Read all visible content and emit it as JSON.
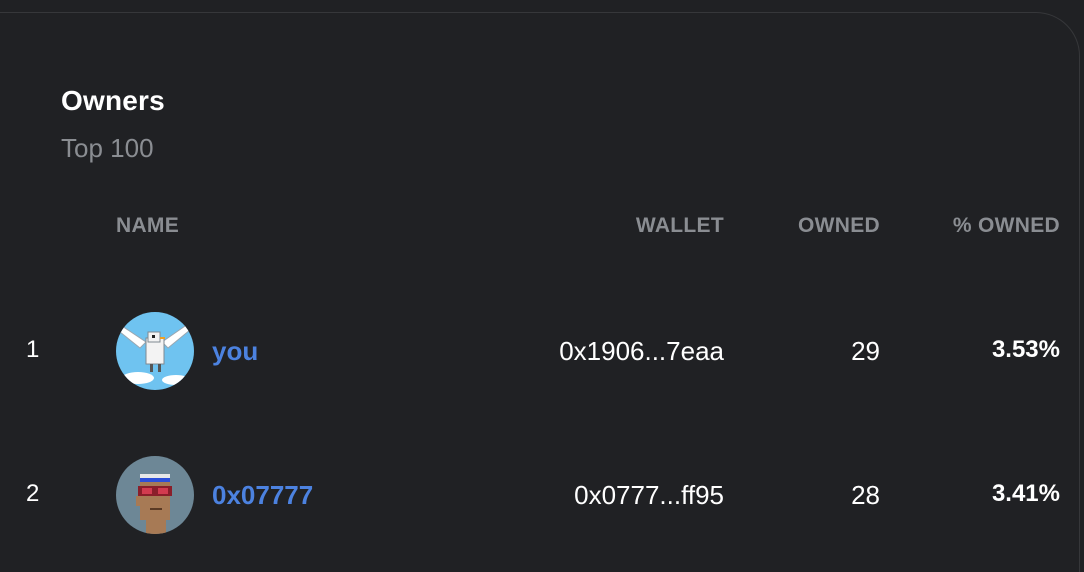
{
  "header": {
    "title": "Owners",
    "subtitle": "Top 100"
  },
  "columns": {
    "name": "NAME",
    "wallet": "WALLET",
    "owned": "OWNED",
    "pct_owned": "% OWNED"
  },
  "rows": [
    {
      "rank": "1",
      "avatar_icon": "pixel-bird-avatar",
      "name": "you",
      "wallet": "0x1906...7eaa",
      "owned": "29",
      "pct_owned": "3.53%"
    },
    {
      "rank": "2",
      "avatar_icon": "pixel-punk-avatar",
      "name": "0x07777",
      "wallet": "0x0777...ff95",
      "owned": "28",
      "pct_owned": "3.41%"
    }
  ],
  "colors": {
    "background": "#202124",
    "link": "#4c82e0",
    "muted": "#8a8d92"
  }
}
